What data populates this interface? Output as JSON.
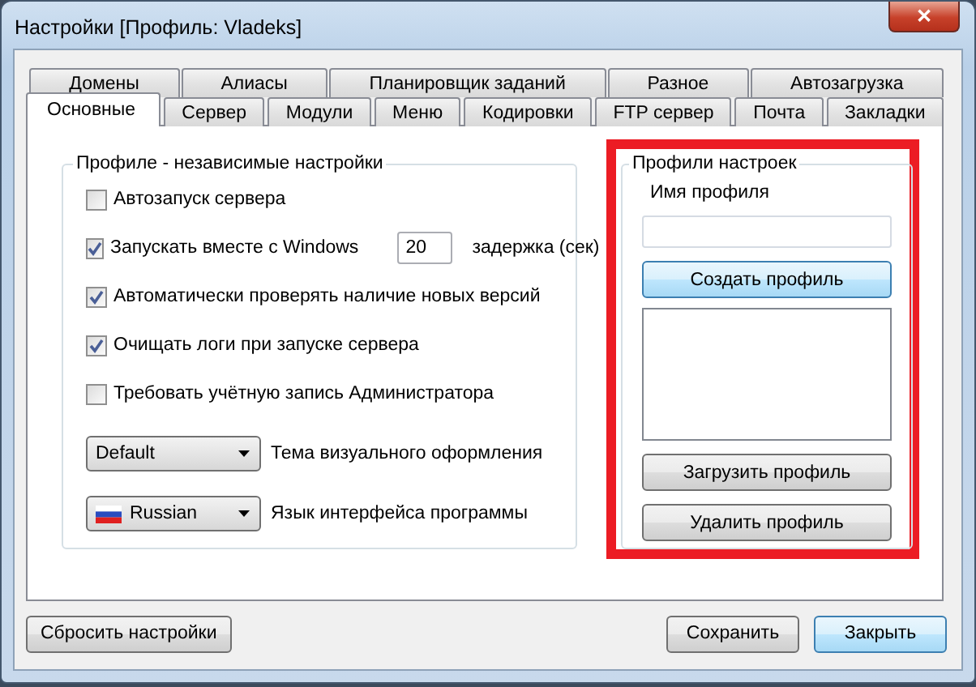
{
  "window": {
    "title": "Настройки [Профиль: Vladeks]",
    "close": "✕"
  },
  "tab_rows": [
    {
      "tabs": [
        {
          "label": "Домены",
          "selected": false
        },
        {
          "label": "Алиасы",
          "selected": false
        },
        {
          "label": "Планировщик заданий",
          "selected": false
        },
        {
          "label": "Разное",
          "selected": false
        },
        {
          "label": "Автозагрузка",
          "selected": false
        }
      ]
    },
    {
      "tabs": [
        {
          "label": "Основные",
          "selected": true
        },
        {
          "label": "Сервер",
          "selected": false
        },
        {
          "label": "Модули",
          "selected": false
        },
        {
          "label": "Меню",
          "selected": false
        },
        {
          "label": "Кодировки",
          "selected": false
        },
        {
          "label": "FTP сервер",
          "selected": false
        },
        {
          "label": "Почта",
          "selected": false
        },
        {
          "label": "Закладки",
          "selected": false
        }
      ]
    }
  ],
  "general_group": {
    "title": "Профиле - независимые настройки",
    "options": [
      {
        "kind": "checkbox",
        "label": "Автозапуск сервера",
        "checked": false
      },
      {
        "kind": "checkbox_delay",
        "label": "Запускать вместе с Windows",
        "checked": true,
        "value": "20",
        "suffix": "задержка (сек)"
      },
      {
        "kind": "checkbox",
        "label": "Автоматически проверять наличие новых версий",
        "checked": true
      },
      {
        "kind": "checkbox",
        "label": "Очищать логи при запуске сервера",
        "checked": true
      },
      {
        "kind": "checkbox",
        "label": "Требовать учётную запись Администратора",
        "checked": false
      }
    ],
    "dropdowns": [
      {
        "kind": "plain",
        "value": "Default",
        "label": "Тема визуального оформления"
      },
      {
        "kind": "flag",
        "value": "Russian",
        "label": "Язык интерфейса программы"
      }
    ]
  },
  "profiles_group": {
    "title": "Профили настроек",
    "name_label": "Имя профиля",
    "buttons": [
      {
        "label": "Создать профиль",
        "focused": true
      },
      {
        "label": "Загрузить профиль",
        "focused": false
      },
      {
        "label": "Удалить профиль",
        "focused": false
      }
    ]
  },
  "footer": {
    "left_buttons": [
      {
        "label": "Сбросить настройки",
        "focused": false
      }
    ],
    "right_buttons": [
      {
        "label": "Сохранить",
        "focused": false
      },
      {
        "label": "Закрыть",
        "focused": true
      }
    ]
  }
}
